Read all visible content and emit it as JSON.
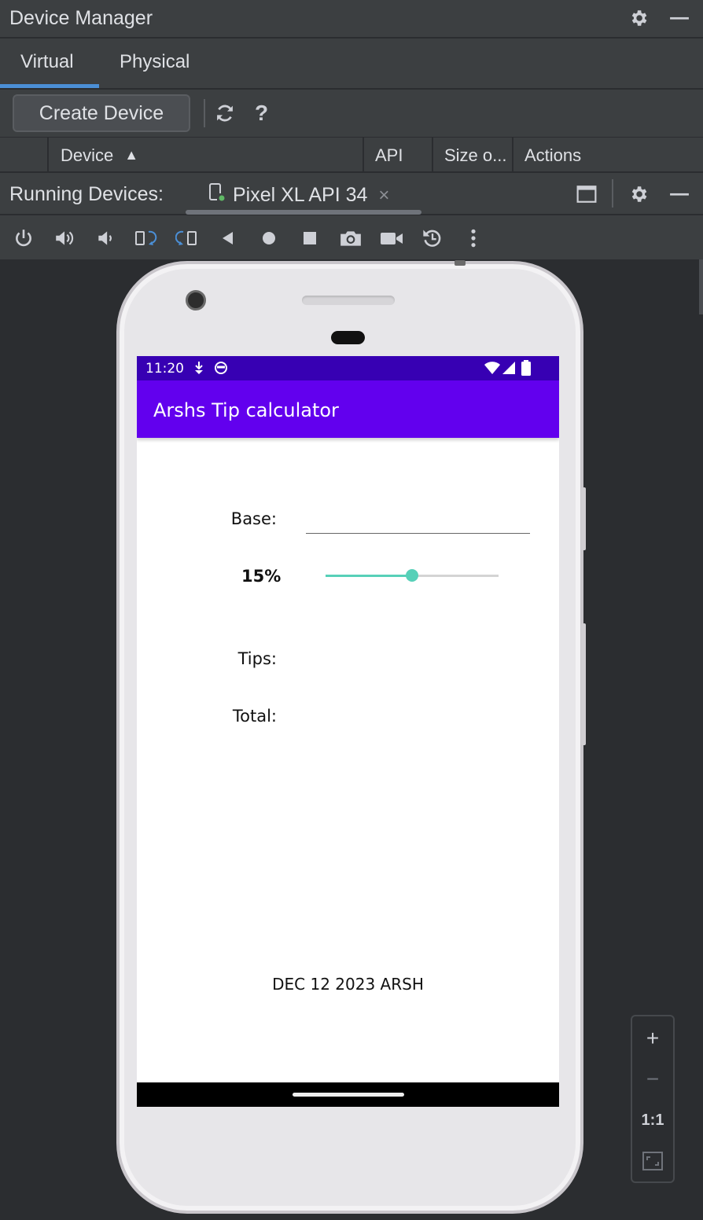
{
  "device_manager": {
    "title": "Device Manager",
    "tabs": [
      {
        "label": "Virtual",
        "active": true
      },
      {
        "label": "Physical",
        "active": false
      }
    ],
    "toolbar": {
      "create_label": "Create Device",
      "help_label": "?"
    },
    "columns": [
      "Device",
      "API",
      "Size o...",
      "Actions"
    ],
    "sort_indicator": "▲"
  },
  "running_devices": {
    "title": "Running Devices:",
    "device_tab": "Pixel XL API 34",
    "close_glyph": "×"
  },
  "emulator": {
    "status_bar": {
      "time": "11:20"
    },
    "app_title": "Arshs Tip calculator",
    "labels": {
      "base": "Base:",
      "tips": "Tips:",
      "total": "Total:"
    },
    "base_input": {
      "value": "",
      "placeholder": ""
    },
    "tip_percent_label": "15%",
    "tip_percent_value": 15,
    "slider_fraction": 0.5,
    "footer_text": "DEC 12 2023 ARSH"
  },
  "zoom": {
    "in_label": "+",
    "out_label": "−",
    "actual_label": "1:1"
  },
  "colors": {
    "ide_panel": "#3c3f41",
    "ide_background": "#2b2d30",
    "tab_accent": "#4b8fd6",
    "status_bar": "#3700b3",
    "app_bar": "#6200ee",
    "slider": "#57d0b8"
  },
  "icons": [
    "gear-icon",
    "minimize-icon",
    "refresh-icon",
    "help-icon",
    "sort-up-icon",
    "phone-device-icon",
    "close-icon",
    "window-icon",
    "power-icon",
    "volume-up-icon",
    "volume-down-icon",
    "rotate-left-icon",
    "rotate-right-icon",
    "back-icon",
    "home-icon",
    "overview-icon",
    "camera-icon",
    "video-icon",
    "snapshot-icon",
    "more-icon",
    "zoom-in-icon",
    "zoom-out-icon",
    "fit-screen-icon"
  ]
}
